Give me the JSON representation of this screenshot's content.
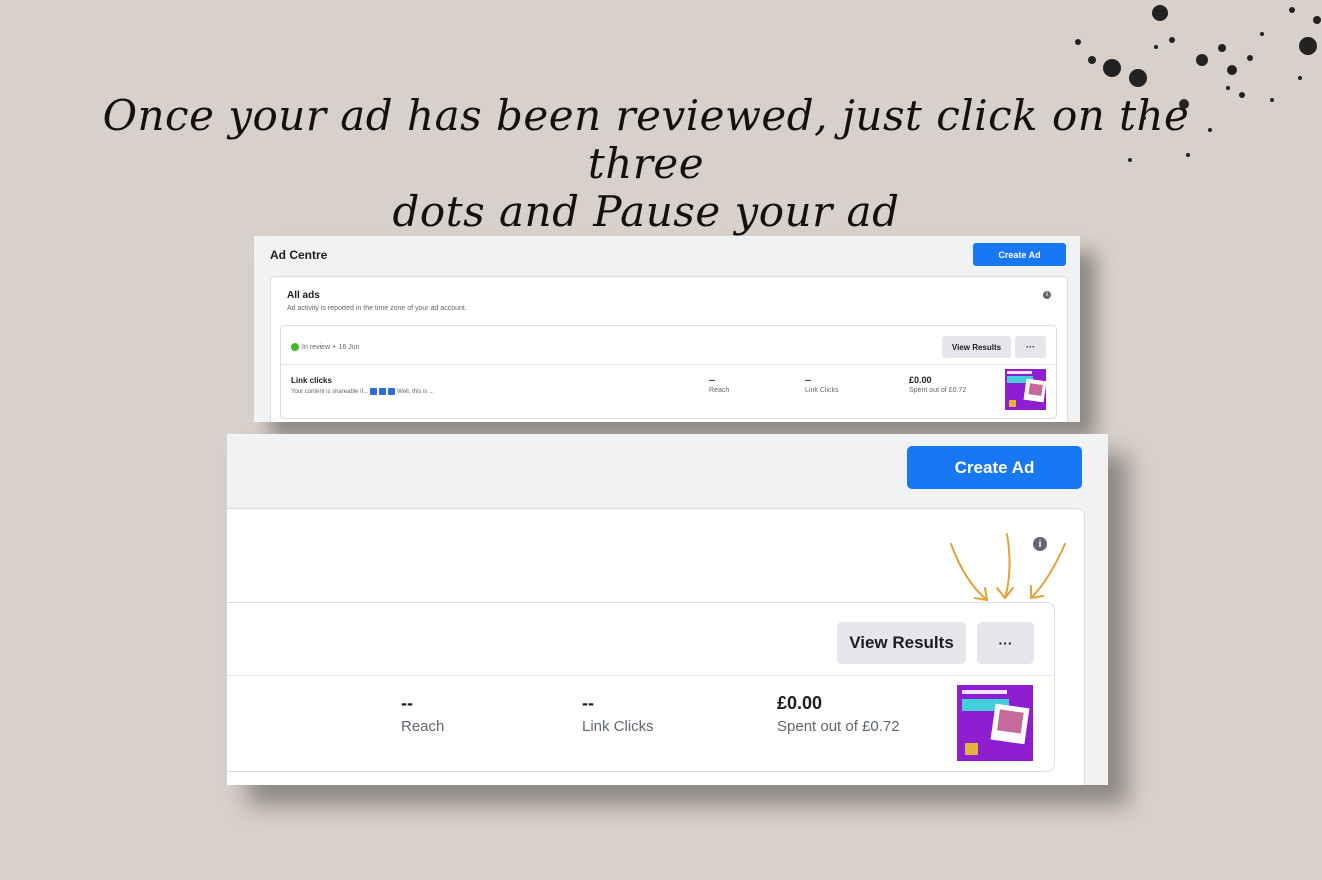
{
  "headline": {
    "line1": "Once your ad has been reviewed, just click on the three",
    "line2": "dots and Pause your ad"
  },
  "colors": {
    "accent": "#1877f2",
    "status_green": "#42b72a",
    "background": "#d8d0ca",
    "arrow": "#e0a33c"
  },
  "small_panel": {
    "title": "Ad Centre",
    "create_ad": "Create Ad",
    "all_ads_title": "All ads",
    "all_ads_subtitle": "Ad activity is reported in the time zone of your ad account.",
    "status": "In review",
    "status_sep": "•",
    "date": "16 Jun",
    "view_results": "View Results",
    "more": "···",
    "ad_name": "Link clicks",
    "ad_desc_start": "Your content is shareable if...",
    "ad_desc_end": "Well, this is ...",
    "reach_value": "--",
    "reach_label": "Reach",
    "clicks_value": "--",
    "clicks_label": "Link Clicks",
    "spent_value": "£0.00",
    "spent_label": "Spent out of £0.72"
  },
  "large_panel": {
    "create_ad": "Create Ad",
    "view_results": "View Results",
    "more": "···",
    "reach_value": "--",
    "reach_label": "Reach",
    "clicks_value": "--",
    "clicks_label": "Link Clicks",
    "spent_value": "£0.00",
    "spent_label": "Spent out of £0.72"
  },
  "icons": {
    "info": "info-icon",
    "more": "more-dots-icon",
    "status": "status-dot-icon",
    "arrows": "pointing-arrows-icon",
    "splatter": "ink-splatter-decoration"
  }
}
